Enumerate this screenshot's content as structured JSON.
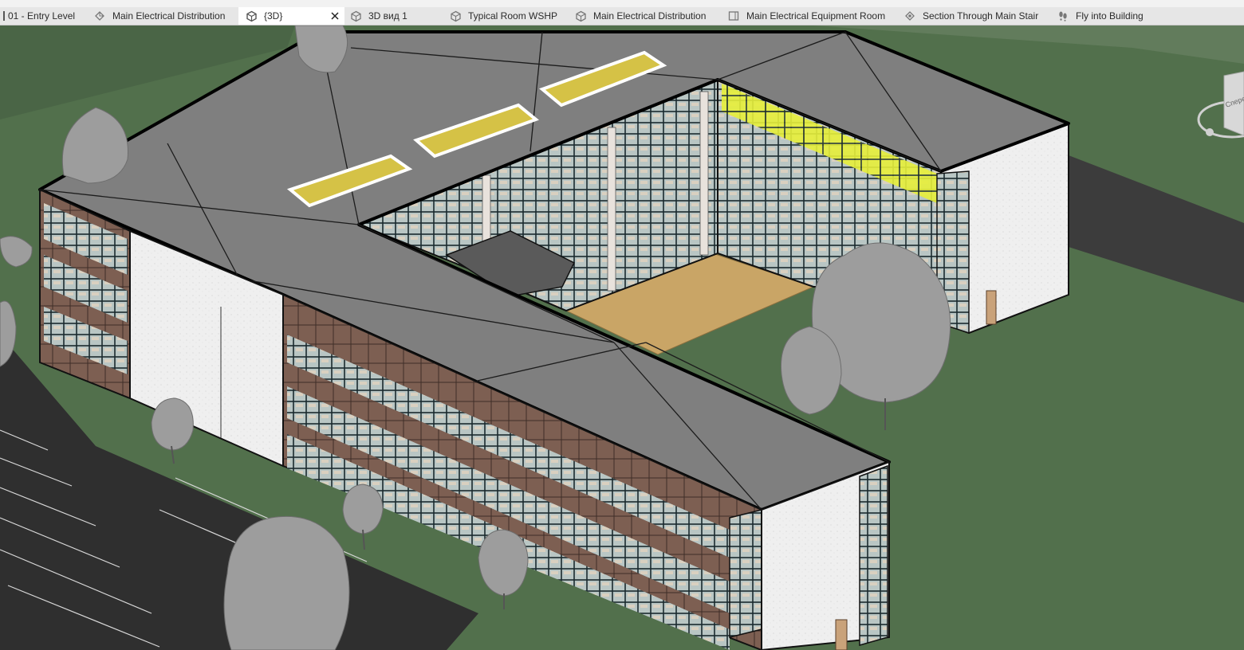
{
  "tabs": [
    {
      "label": "01 - Entry Level",
      "icon": "floor-plan-icon",
      "active": false
    },
    {
      "label": "Main Electrical Distribution",
      "icon": "plan-view-icon",
      "active": false
    },
    {
      "label": "{3D}",
      "icon": "3d-view-icon",
      "active": true
    },
    {
      "label": "3D вид 1",
      "icon": "3d-view-icon",
      "active": false
    },
    {
      "label": "Typical Room WSHP",
      "icon": "3d-view-icon",
      "active": false
    },
    {
      "label": "Main Electrical Distribution",
      "icon": "3d-view-icon",
      "active": false
    },
    {
      "label": "Main Electrical Equipment Room",
      "icon": "sheet-icon",
      "active": false
    },
    {
      "label": "Section Through Main Stair",
      "icon": "section-icon",
      "active": false
    },
    {
      "label": "Fly into Building",
      "icon": "walkthrough-icon",
      "active": false
    }
  ],
  "close_icon": "close-icon",
  "viewcube": {
    "label": "Спереди"
  },
  "colors": {
    "grass": "#52704c",
    "roof": "#808080",
    "wall": "#eeeeee",
    "brick": "#7a5c50",
    "glass": "#b8c7c9",
    "glass_highlight": "#e8f040",
    "floor": "#c9a566",
    "road": "#3d3d3d",
    "tree": "#9a9a9a"
  }
}
